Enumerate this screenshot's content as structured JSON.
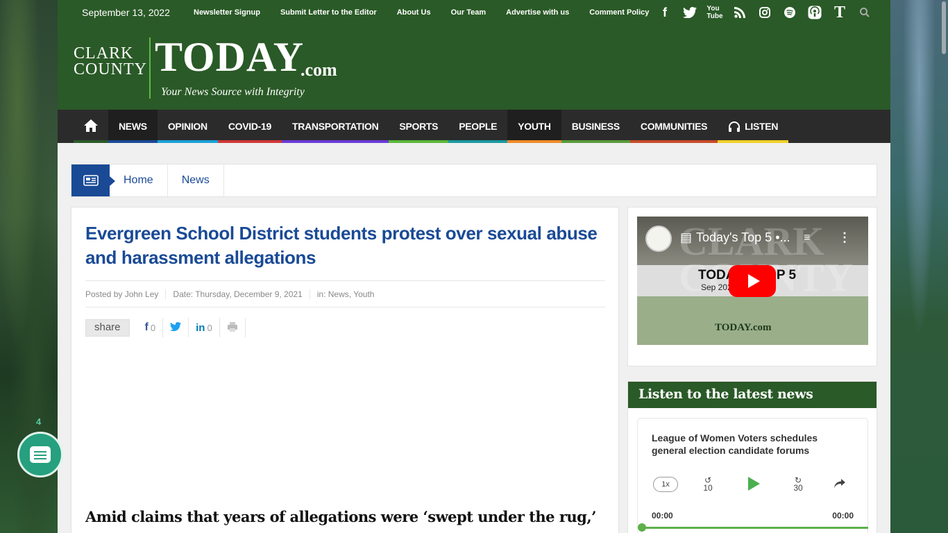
{
  "topbar": {
    "date": "September 13, 2022",
    "links": [
      "Newsletter Signup",
      "Submit Letter to the Editor",
      "About Us",
      "Our Team",
      "Advertise with us",
      "Comment Policy"
    ],
    "social_icons": [
      "facebook-icon",
      "twitter-icon",
      "youtube-icon",
      "rss-icon",
      "instagram-icon",
      "spotify-icon",
      "podcast-icon",
      "tiktok-t-icon",
      "search-icon"
    ]
  },
  "logo": {
    "clark": "CLARK",
    "county": "COUNTY",
    "today": "TODAY",
    "dotcom": ".com",
    "tagline": "Your News Source with Integrity"
  },
  "nav": {
    "items": [
      {
        "label": "NEWS",
        "color": "#1a4a96"
      },
      {
        "label": "OPINION",
        "color": "#1aa0d8"
      },
      {
        "label": "COVID-19",
        "color": "#d03838"
      },
      {
        "label": "TRANSPORTATION",
        "color": "#6a3ad8"
      },
      {
        "label": "SPORTS",
        "color": "#5ab83a"
      },
      {
        "label": "PEOPLE",
        "color": "#1a9aa0"
      },
      {
        "label": "YOUTH",
        "color": "#f08a28"
      },
      {
        "label": "BUSINESS",
        "color": "#5a9a3a"
      },
      {
        "label": "COMMUNITIES",
        "color": "#c84a2a"
      },
      {
        "label": "LISTEN",
        "color": "#f0d028"
      }
    ]
  },
  "breadcrumb": {
    "home": "Home",
    "news": "News"
  },
  "article": {
    "title": "Evergreen School District students protest over sexual abuse and harassment allegations",
    "author": "Posted by John Ley",
    "date": "Date: Thursday, December 9, 2021",
    "in_label": "in:",
    "categories": "News, Youth",
    "share": "share",
    "fb_count": "0",
    "li_count": "0",
    "subhead": "Amid claims that years of allegations were ‘swept under the rug,’"
  },
  "video": {
    "title": "Today's Top 5 •...",
    "overlay": "TODAY'S TOP 5",
    "overlay_date": "Sep 2022",
    "mini_logo": "TODAY.com"
  },
  "listen": {
    "heading": "Listen to the latest news",
    "episode": "League of Women Voters schedules general election candidate forums",
    "speed": "1x",
    "skip_back": "10",
    "skip_fwd": "30",
    "current": "00:00",
    "duration": "00:00"
  },
  "chat": {
    "count": "4"
  }
}
